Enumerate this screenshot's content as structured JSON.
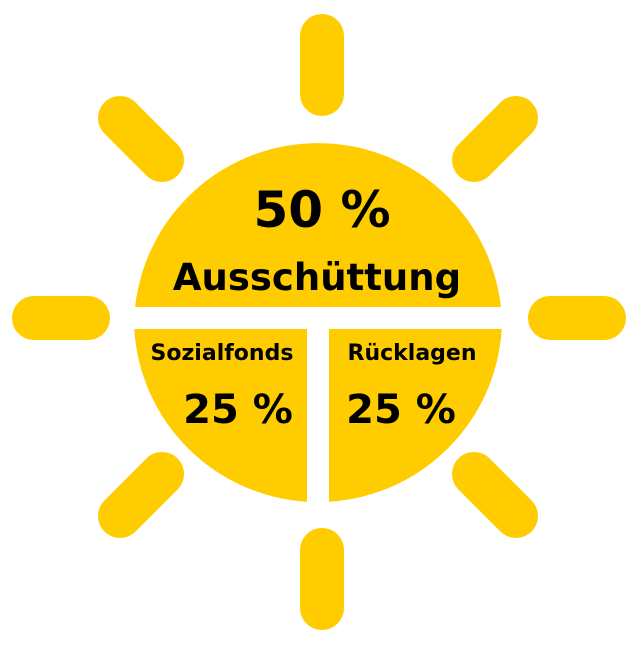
{
  "diagram": {
    "sun_color": "#ffcc00",
    "background_color": "#ffffff",
    "text_color": "#000000",
    "segments": [
      {
        "id": "ausschuettung",
        "label": "Ausschüttung",
        "percent_text": "50 %",
        "share": 0.5
      },
      {
        "id": "sozialfonds",
        "label": "Sozialfonds",
        "percent_text": "25 %",
        "share": 0.25
      },
      {
        "id": "ruecklagen",
        "label": "Rücklagen",
        "percent_text": "25 %",
        "share": 0.25
      }
    ]
  }
}
